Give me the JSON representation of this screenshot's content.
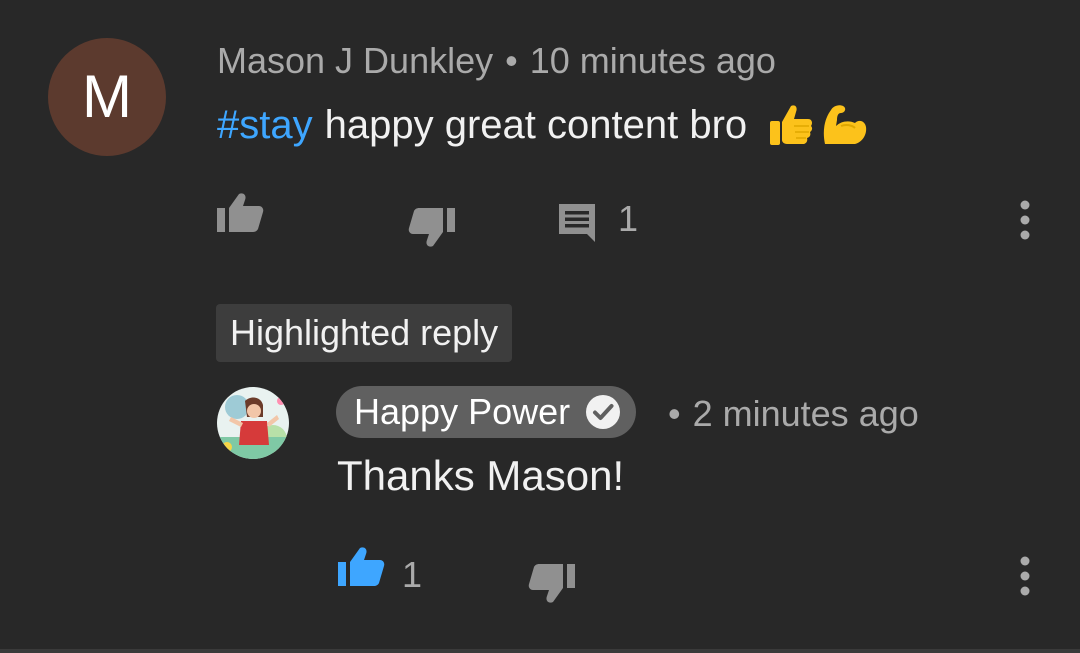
{
  "comment": {
    "avatar_letter": "M",
    "author": "Mason J Dunkley",
    "separator": "•",
    "time": "10 minutes ago",
    "hashtag": "#stay",
    "text": "happy great content bro",
    "emojis": [
      "thumbs-up-emoji",
      "flexed-biceps-emoji"
    ],
    "reply_count": "1"
  },
  "highlight": {
    "label": "Highlighted reply"
  },
  "reply": {
    "author": "Happy Power",
    "verified": true,
    "separator": "•",
    "time": "2 minutes ago",
    "text": "Thanks Mason!",
    "like_count": "1"
  },
  "colors": {
    "background": "#282828",
    "link_blue": "#3ea6ff",
    "muted": "#aaaaaa",
    "icon_gray": "#909090",
    "chip_gray": "#606060",
    "avatar_brown": "#5c3a2e"
  }
}
